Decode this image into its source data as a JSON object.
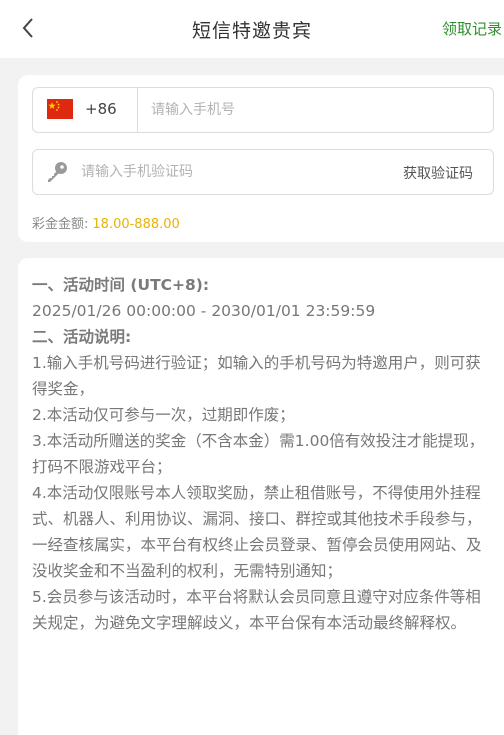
{
  "header": {
    "title": "短信特邀贵宾",
    "records_link": "领取记录"
  },
  "form": {
    "country_code": "+86",
    "phone_placeholder": "请输入手机号",
    "code_placeholder": "请输入手机验证码",
    "get_code_label": "获取验证码",
    "bonus_label": "彩金金额:",
    "bonus_value": "18.00-888.00"
  },
  "rules": {
    "time_heading": "一、活动时间 (UTC+8):",
    "time_range": "2025/01/26 00:00:00 - 2030/01/01 23:59:59",
    "desc_heading": "二、活动说明:",
    "items": [
      "1.输入手机号码进行验证；如输入的手机号码为特邀用户，则可获得奖金，",
      "2.本活动仅可参与一次，过期即作废；",
      "3.本活动所赠送的奖金（不含本金）需1.00倍有效投注才能提现，打码不限游戏平台；",
      "4.本活动仅限账号本人领取奖励，禁止租借账号，不得使用外挂程式、机器人、利用协议、漏洞、接口、群控或其他技术手段参与，一经查核属实，本平台有权终止会员登录、暂停会员使用网站、及没收奖金和不当盈利的权利，无需特别通知；",
      "5.会员参与该活动时，本平台将默认会员同意且遵守对应条件等相关规定，为避免文字理解歧义，本平台保有本活动最终解释权。"
    ]
  },
  "colors": {
    "accent_green": "#2f8f2f",
    "bonus_gold": "#e9b300"
  },
  "icons": [
    "chevron-left-icon",
    "china-flag-icon",
    "key-icon"
  ]
}
